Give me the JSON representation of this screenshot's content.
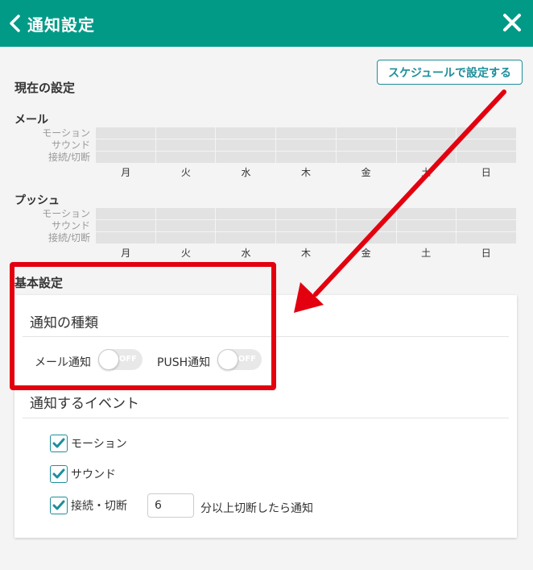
{
  "header": {
    "title": "通知設定",
    "back_icon": "chevron-left-icon",
    "close_icon": "close-icon"
  },
  "schedule_button": {
    "label": "スケジュールで設定する"
  },
  "current_settings": {
    "title": "現在の設定",
    "mail": {
      "title": "メール",
      "rows": [
        "モーション",
        "サウンド",
        "接続/切断"
      ]
    },
    "push": {
      "title": "プッシュ",
      "rows": [
        "モーション",
        "サウンド",
        "接続/切断"
      ]
    },
    "days": [
      "月",
      "火",
      "水",
      "木",
      "金",
      "土",
      "日"
    ]
  },
  "basic_settings": {
    "title": "基本設定",
    "notification_types": {
      "heading": "通知の種類",
      "mail_label": "メール通知",
      "push_label": "PUSH通知",
      "mail_state": "OFF",
      "push_state": "OFF"
    },
    "events": {
      "heading": "通知するイベント",
      "items": [
        {
          "label": "モーション",
          "checked": true
        },
        {
          "label": "サウンド",
          "checked": true
        },
        {
          "label": "接続・切断",
          "checked": true
        }
      ],
      "minutes_value": "6",
      "minutes_suffix": "分以上切断したら通知"
    }
  },
  "colors": {
    "header": "#009a87",
    "accent": "#1d8f9a",
    "highlight": "#e3000f",
    "grid_cell": "#e2e2e2"
  }
}
